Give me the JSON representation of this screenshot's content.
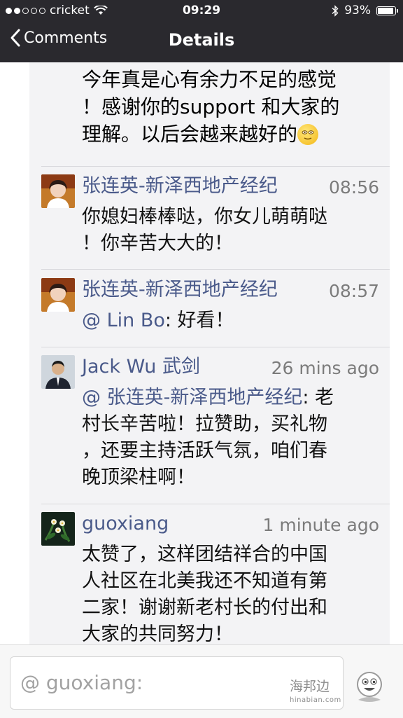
{
  "status_bar": {
    "carrier": "cricket",
    "time": "09:29",
    "battery": "93%",
    "battery_level": 0.93
  },
  "nav": {
    "back_label": "Comments",
    "title": "Details"
  },
  "top_comment_text": [
    "今年真是心有余力不足的感觉",
    "！感谢你的support 和大家的",
    "理解。以后会越来越好的"
  ],
  "comments": [
    {
      "author": "张连英-新泽西地产经纪",
      "time": "08:56",
      "lines": [
        "你媳妇棒棒哒，你女儿萌萌哒",
        "！你辛苦大大的！"
      ]
    },
    {
      "author": "张连英-新泽西地产经纪",
      "time": "08:57",
      "mention": "@ Lin Bo",
      "after_mention": ": 好看！"
    },
    {
      "author": "Jack Wu 武剑",
      "time": "26 mins ago",
      "mention": "@ 张连英-新泽西地产经纪",
      "after_mention": ": 老",
      "lines": [
        "村长辛苦啦！拉赞助，买礼物",
        "，还要主持活跃气氛，咱们春",
        "晚顶梁柱啊！"
      ]
    },
    {
      "author": "guoxiang",
      "time": "1 minute ago",
      "lines": [
        "太赞了，这样团结祥合的中国",
        "人社区在北美我还不知道有第",
        "二家！谢谢新老村长的付出和",
        "大家的共同努力！"
      ]
    }
  ],
  "input": {
    "placeholder": "@ guoxiang:"
  },
  "watermark": {
    "title": "海邦边",
    "url": "hinabian.com"
  },
  "colors": {
    "bar": "#2a292e",
    "name": "#4a5a8a",
    "panel": "#f3f3f5"
  }
}
